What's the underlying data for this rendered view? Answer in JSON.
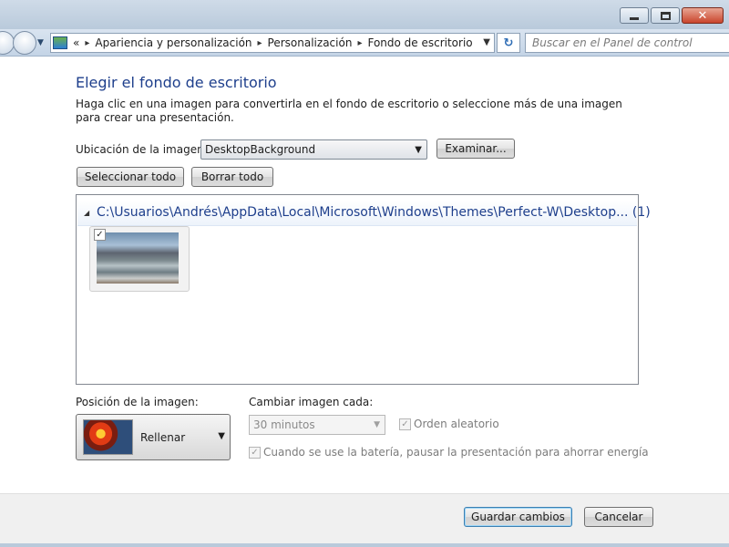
{
  "window": {
    "minimize_icon": "minimize-icon",
    "maximize_icon": "maximize-icon",
    "close_icon": "close-icon"
  },
  "nav": {
    "breadcrumb_lead": "«",
    "breadcrumbs": [
      "Apariencia y personalización",
      "Personalización",
      "Fondo de escritorio"
    ],
    "separator": "▸",
    "refresh_glyph": "↻",
    "search_placeholder": "Buscar en el Panel de control"
  },
  "page": {
    "heading": "Elegir el fondo de escritorio",
    "description": "Haga clic en una imagen para convertirla en el fondo de escritorio o seleccione más de una imagen para crear una presentación."
  },
  "location": {
    "label": "Ubicación de la imagen:",
    "selected": "DesktopBackground",
    "browse_label": "Examinar..."
  },
  "selection": {
    "select_all_label": "Seleccionar todo",
    "clear_all_label": "Borrar todo"
  },
  "image_list": {
    "group_path": "C:\\Usuarios\\Andrés\\AppData\\Local\\Microsoft\\Windows\\Themes\\Perfect-W\\Desktop... (1)",
    "thumbnail_checked": "✓"
  },
  "position": {
    "label": "Posición de la imagen:",
    "value": "Rellenar"
  },
  "interval": {
    "label": "Cambiar imagen cada:",
    "value": "30 minutos",
    "shuffle_label": "Orden aleatorio",
    "battery_label": "Cuando se use la batería, pausar la presentación para ahorrar energía",
    "check_glyph": "✓"
  },
  "footer": {
    "save_label": "Guardar cambios",
    "cancel_label": "Cancelar"
  }
}
